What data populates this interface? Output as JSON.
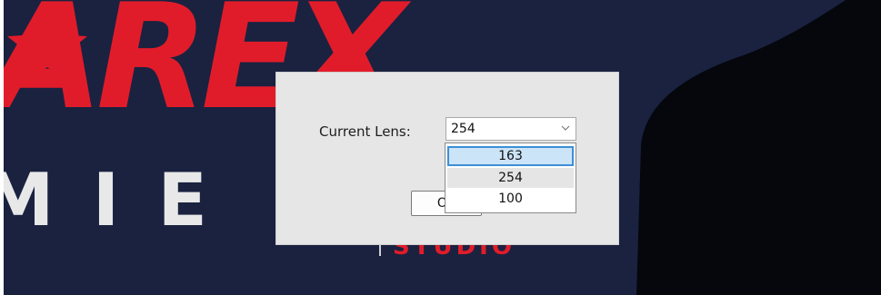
{
  "background": {
    "brand_letters_top": "AREX",
    "brand_letters_row": "MIE",
    "brand_subtext": "STUDIO"
  },
  "dialog": {
    "lens_label": "Current Lens:",
    "selected_value": "254",
    "ok_label": "OK"
  },
  "dropdown": {
    "options": [
      {
        "label": "163",
        "state": "highlighted"
      },
      {
        "label": "254",
        "state": "selected"
      },
      {
        "label": "100",
        "state": "normal"
      }
    ]
  },
  "colors": {
    "brand_red": "#e11c2a",
    "background_navy": "#1a2240",
    "highlight_blue": "#cce4f7"
  }
}
